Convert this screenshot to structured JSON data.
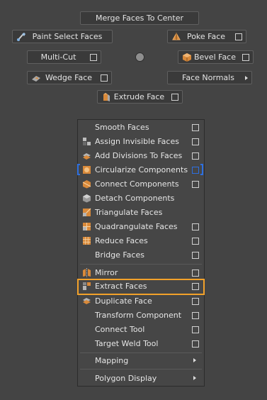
{
  "top_buttons": {
    "merge_center": "Merge Faces To Center",
    "paint_select": "Paint Select Faces",
    "poke_face": "Poke Face",
    "multi_cut": "Multi-Cut",
    "bevel_face": "Bevel Face",
    "wedge_face": "Wedge Face",
    "face_normals": "Face Normals",
    "extrude_face": "Extrude Face"
  },
  "icons": {
    "paint_select": "paint-brush-icon",
    "poke_face": "poke-face-icon",
    "bevel_face": "bevel-cube-icon",
    "wedge_face": "wedge-face-icon",
    "extrude_face": "extrude-face-icon"
  },
  "menu": {
    "items": [
      {
        "label": "Smooth Faces",
        "icon": "",
        "checkbox": true
      },
      {
        "label": "Assign Invisible Faces",
        "icon": "invisible-faces-icon",
        "checkbox": true
      },
      {
        "label": "Add Divisions To Faces",
        "icon": "add-divisions-icon",
        "checkbox": true
      },
      {
        "label": "Circularize Components",
        "icon": "circularize-icon",
        "checkbox": true,
        "bracketed": true
      },
      {
        "label": "Connect Components",
        "icon": "connect-components-icon",
        "checkbox": true
      },
      {
        "label": "Detach Components",
        "icon": "detach-components-icon",
        "checkbox": false
      },
      {
        "label": "Triangulate Faces",
        "icon": "triangulate-icon",
        "checkbox": false
      },
      {
        "label": "Quadrangulate Faces",
        "icon": "quadrangulate-icon",
        "checkbox": true
      },
      {
        "label": "Reduce Faces",
        "icon": "reduce-faces-icon",
        "checkbox": true
      },
      {
        "label": "Bridge Faces",
        "icon": "",
        "checkbox": true
      },
      {
        "label": "Mirror",
        "icon": "mirror-icon",
        "checkbox": true
      },
      {
        "label": "Extract Faces",
        "icon": "extract-faces-icon",
        "checkbox": true,
        "highlighted": true
      },
      {
        "label": "Duplicate Face",
        "icon": "duplicate-face-icon",
        "checkbox": true
      },
      {
        "label": "Transform Component",
        "icon": "",
        "checkbox": true
      },
      {
        "label": "Connect Tool",
        "icon": "",
        "checkbox": true
      },
      {
        "label": "Target Weld Tool",
        "icon": "",
        "checkbox": true
      },
      {
        "label": "Mapping",
        "icon": "",
        "submenu": true
      },
      {
        "label": "Polygon Display",
        "icon": "",
        "submenu": true
      }
    ]
  },
  "colors": {
    "highlight_outline": "#f2a12a",
    "bracket_blue": "#2d6fe0",
    "icon_orange": "#d8893a",
    "background": "#444444"
  }
}
